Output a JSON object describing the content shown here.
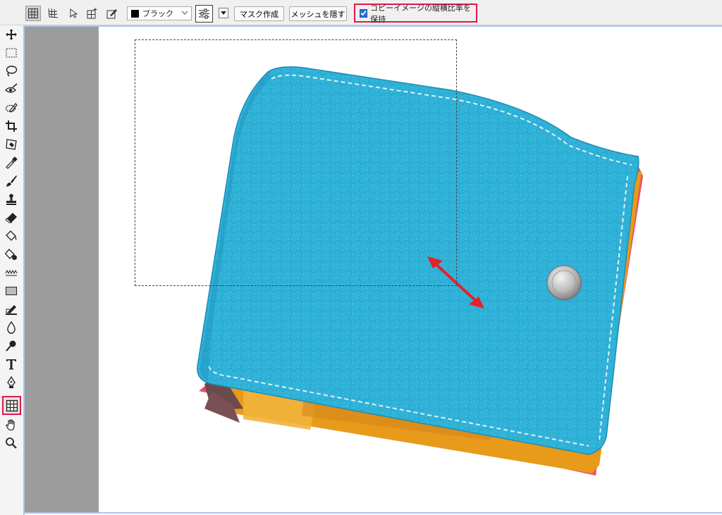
{
  "toolbar": {
    "modes": [
      "grid-mode-icon",
      "warp-grid-mode-icon",
      "select-point-icon",
      "add-grid-icon",
      "eyedropper-edit-icon"
    ],
    "color_label": "ブラック",
    "color_value": "#000000",
    "mask_button": "マスク作成",
    "mesh_button": "メッシュを隠す",
    "aspect_checkbox_label": "コピーイメージの縦横比率を保持",
    "aspect_checked": true
  },
  "tools": [
    "move-icon",
    "rect-marquee-icon",
    "lasso-icon",
    "eye-select-icon",
    "pen-select-icon",
    "crop-icon",
    "stamp-select-icon",
    "eyedropper-icon",
    "brush-icon",
    "clone-stamp-icon",
    "eraser-icon",
    "paint-bucket-icon",
    "color-replace-icon",
    "wave-icon",
    "rectangle-shape-icon",
    "pen-edit-icon",
    "blur-drop-icon",
    "dodge-icon",
    "text-icon",
    "pen-tool-icon",
    "mesh-warp-icon",
    "hand-icon",
    "zoom-icon"
  ],
  "active_tool": "mesh-warp-icon",
  "colors": {
    "highlight": "#e0184d",
    "wallet_leather": "#2fb3d9",
    "wallet_interior": "#e89a1a",
    "wallet_edge": "#e8506a",
    "arrow": "#e8202a"
  }
}
